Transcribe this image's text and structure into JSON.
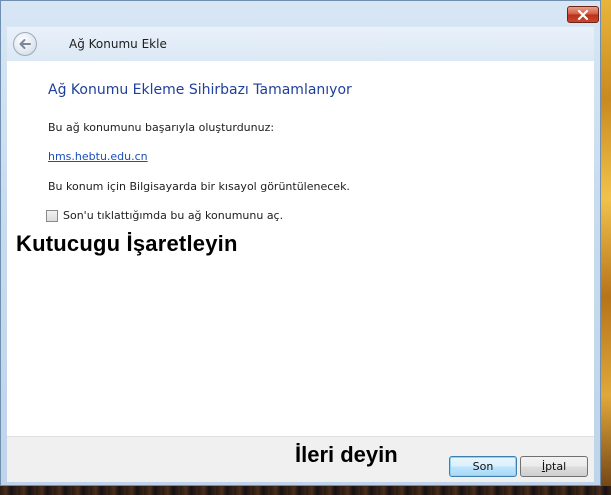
{
  "window": {
    "title": "Ağ Konumu Ekle"
  },
  "content": {
    "heading": "Ağ Konumu Ekleme Sihirbazı Tamamlanıyor",
    "success_text": "Bu ağ konumunu başarıyla oluşturdunuz:",
    "location_link": "hms.hebtu.edu.cn",
    "shortcut_text": "Bu konum için Bilgisayarda bir kısayol görüntülenecek.",
    "checkbox_label": "Son'u tıklattığımda bu ağ konumunu aç.",
    "checkbox_checked": false
  },
  "annotations": {
    "check_instruction": "Kutucugu İşaretleyin",
    "next_instruction": "İleri deyin"
  },
  "buttons": {
    "finish_label": "Son",
    "cancel_label_first": "İ",
    "cancel_label_rest": "ptal"
  },
  "icons": {
    "close": "close-icon",
    "back": "back-arrow-icon"
  },
  "colors": {
    "heading": "#1f3f9a",
    "link": "#1a4dbd",
    "close_button": "#c9462c"
  }
}
